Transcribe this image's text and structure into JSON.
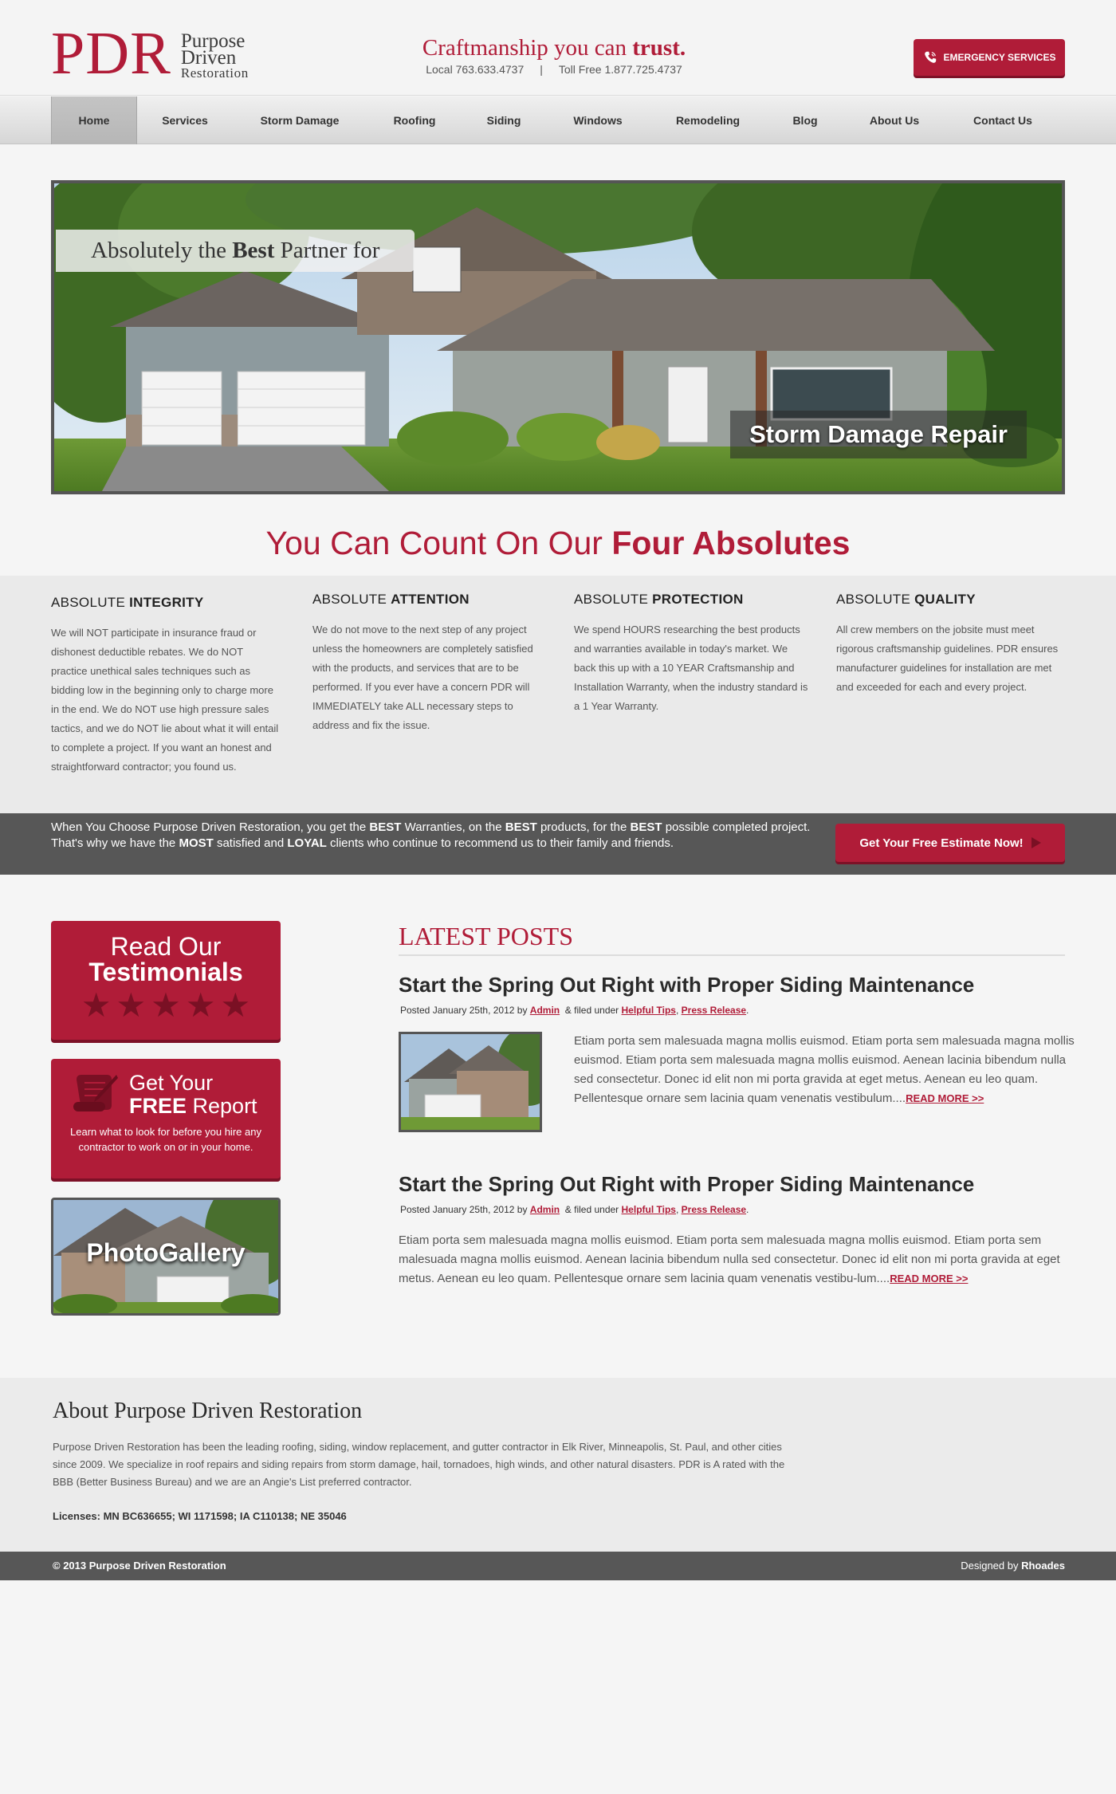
{
  "header": {
    "logo_mark": "PDR",
    "logo_words": [
      "Purpose",
      "Driven",
      "Restoration"
    ],
    "tagline_main": "Craftmanship you can ",
    "tagline_emph": "trust.",
    "phone_local": "Local 763.633.4737",
    "phone_sep": "|",
    "phone_tollfree": "Toll Free 1.877.725.4737",
    "emergency_label": "EMERGENCY SERVICES"
  },
  "nav": {
    "items": [
      {
        "label": "Home",
        "active": true
      },
      {
        "label": "Services"
      },
      {
        "label": "Storm Damage"
      },
      {
        "label": "Roofing"
      },
      {
        "label": "Siding"
      },
      {
        "label": "Windows"
      },
      {
        "label": "Remodeling"
      },
      {
        "label": "Blog"
      },
      {
        "label": "About Us"
      },
      {
        "label": "Contact Us"
      }
    ]
  },
  "hero": {
    "caption_pre": "Absolutely the ",
    "caption_emph": "Best",
    "caption_post": " Partner for",
    "caption_service": "Storm Damage Repair"
  },
  "absolutes": {
    "heading_pre": "You Can Count On Our ",
    "heading_emph": "Four Absolutes",
    "cols": [
      {
        "pre": "ABSOLUTE ",
        "emph": "INTEGRITY",
        "text": "We will NOT participate in insurance fraud or dishonest deductible rebates. We do NOT practice unethical sales techniques such as bidding low in the beginning only to charge more in the end. We do NOT use high pressure sales tactics, and we do NOT lie about what it will entail to complete a project. If you want an honest and straightforward contractor; you found us."
      },
      {
        "pre": "ABSOLUTE ",
        "emph": "ATTENTION",
        "text": "We do not move to the next step of any project unless the homeowners are completely satisfied with the products, and services that are to be performed. If you ever have a concern PDR will IMMEDIATELY take ALL necessary steps to address and fix the issue."
      },
      {
        "pre": "ABSOLUTE ",
        "emph": "PROTECTION",
        "text": "We spend HOURS researching the best products and warranties available in today's market. We back this up with a 10 YEAR Craftsmanship and Installation Warranty, when the industry standard is a 1 Year Warranty."
      },
      {
        "pre": "ABSOLUTE ",
        "emph": "QUALITY",
        "text": "All crew members on the jobsite must meet rigorous craftsmanship guidelines. PDR ensures manufacturer guidelines for installation are met and exceeded for each and every project."
      }
    ]
  },
  "cta": {
    "parts": [
      "When You Choose Purpose Driven Restoration, you get the ",
      "BEST",
      " Warranties, on the ",
      "BEST",
      " products, for the ",
      "BEST",
      " possible completed project. That's why we have the ",
      "MOST",
      " satisfied and ",
      "LOYAL",
      " clients who continue to recommend us to their family and friends."
    ],
    "button_label": "Get Your Free Estimate Now!"
  },
  "sidebar": {
    "testimonials_line1": "Read Our",
    "testimonials_line2": "Testimonials",
    "stars": [
      "★",
      "★",
      "★",
      "★",
      "★"
    ],
    "report_line1": "Get Your",
    "report_emph": "FREE",
    "report_line2": " Report",
    "report_text": "Learn what to look for  before you hire any contractor to work on or in your home.",
    "gallery_label": "PhotoGallery"
  },
  "posts": {
    "title": "LATEST POSTS",
    "items": [
      {
        "title": "Start the Spring Out Right with Proper Siding Maintenance",
        "meta_posted": "Posted January 25th, 2012 by ",
        "author": "Admin",
        "meta_filed": "  & filed under ",
        "cat1": "Helpful Tips",
        "comma": ", ",
        "cat2": "Press Release",
        "period": ".",
        "body": "Etiam porta sem malesuada magna mollis euismod. Etiam porta sem malesuada magna mollis euismod. Etiam porta sem malesuada magna mollis euismod. Aenean lacinia bibendum nulla sed consectetur. Donec id elit non mi porta gravida at eget metus. Aenean eu leo quam. Pellentesque ornare sem lacinia quam venenatis vestibulum....",
        "read_more": "READ MORE >>"
      },
      {
        "title": "Start the Spring Out Right with Proper Siding Maintenance",
        "meta_posted": "Posted January 25th, 2012 by ",
        "author": "Admin",
        "meta_filed": "  & filed under ",
        "cat1": "Helpful Tips",
        "comma": ", ",
        "cat2": "Press Release",
        "period": ".",
        "body": "Etiam porta sem malesuada magna mollis euismod. Etiam porta sem malesuada magna mollis euismod. Etiam porta sem malesuada magna mollis euismod. Aenean lacinia bibendum nulla sed consectetur. Donec id elit non mi porta gravida at eget metus. Aenean eu leo quam. Pellentesque ornare sem lacinia quam venenatis vestibu-lum....",
        "read_more": "READ MORE >>"
      }
    ]
  },
  "about": {
    "title": "About Purpose Driven Restoration",
    "text": "Purpose Driven Restoration has been the leading roofing, siding, window replacement, and gutter contractor in Elk River, Minneapolis, St. Paul, and other cities since 2009. We specialize in roof repairs and siding repairs from storm damage, hail, tornadoes, high winds, and other natural disasters. PDR is A rated with the BBB (Better Business Bureau) and we are an Angie's List preferred contractor.",
    "licenses": "Licenses: MN BC636655; WI 1171598; IA C110138; NE 35046"
  },
  "footer": {
    "copyright": "© 2013 Purpose Driven Restoration",
    "designed_pre": "Designed by ",
    "designed_by": "Rhoades"
  },
  "colors": {
    "brand_red": "#b01c38",
    "dark_band": "#575757"
  }
}
